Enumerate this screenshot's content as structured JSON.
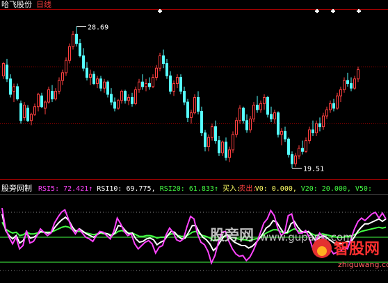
{
  "header": {
    "stock_name": "哈飞股份",
    "period_label": "日线"
  },
  "upper_chart": {
    "high_label": "28.69",
    "low_label": "19.51",
    "star_markers": 4,
    "colors": {
      "up": "#ff4040",
      "down": "#55ffff",
      "axis": "#b00000",
      "text": "#ffffff"
    }
  },
  "indicator": {
    "name": "股旁网制",
    "items": [
      {
        "label": "RSI5: 72.421↑",
        "color": "#ff44ff"
      },
      {
        "label": "RSI10: 69.775,",
        "color": "#ffffff"
      },
      {
        "label": "RSI20: 61.833↑",
        "color": "#44ff44"
      },
      {
        "label": "买入:",
        "color": "#ffff66"
      },
      {
        "label": "卖出:",
        "color": "#ff4040"
      },
      {
        "label": "V0: 0.000,",
        "color": "#ffff66"
      },
      {
        "label": "V20: 20.000,",
        "color": "#44ff44"
      },
      {
        "label": "V50:",
        "color": "#44ff44"
      }
    ]
  },
  "watermark": {
    "site_cn": "股旁网",
    "site_url": "www.gupang.com",
    "logo_text": "智股网",
    "logo_url": "zhiguwang.com"
  },
  "chart_data": [
    {
      "type": "candlestick",
      "title": "",
      "ylim": [
        18.9,
        29.7
      ],
      "high_label": 28.69,
      "low_label": 19.51,
      "candles": [
        [
          25.5,
          26.4,
          25.3,
          26.3
        ],
        [
          26.2,
          26.6,
          25.1,
          25.3
        ],
        [
          25.3,
          25.6,
          24.1,
          24.3
        ],
        [
          24.5,
          25.0,
          23.8,
          24.8
        ],
        [
          24.8,
          25.0,
          23.9,
          24.0
        ],
        [
          23.7,
          23.9,
          22.4,
          22.6
        ],
        [
          22.8,
          23.8,
          22.6,
          23.6
        ],
        [
          23.4,
          23.6,
          22.5,
          22.6
        ],
        [
          22.6,
          23.1,
          22.3,
          23.0
        ],
        [
          23.0,
          23.7,
          22.9,
          23.5
        ],
        [
          23.5,
          24.4,
          23.2,
          24.3
        ],
        [
          24.2,
          24.4,
          23.4,
          23.5
        ],
        [
          23.4,
          23.9,
          23.0,
          23.8
        ],
        [
          23.8,
          24.8,
          23.7,
          24.6
        ],
        [
          24.5,
          24.9,
          23.8,
          24.0
        ],
        [
          24.0,
          24.7,
          23.9,
          24.5
        ],
        [
          24.5,
          25.4,
          24.3,
          25.2
        ],
        [
          25.2,
          25.9,
          24.9,
          25.7
        ],
        [
          25.7,
          26.7,
          25.5,
          26.5
        ],
        [
          26.5,
          27.6,
          26.3,
          27.4
        ],
        [
          27.4,
          28.4,
          27.2,
          28.2
        ],
        [
          28.2,
          28.69,
          27.4,
          27.6
        ],
        [
          27.6,
          27.9,
          26.7,
          26.8
        ],
        [
          26.8,
          27.3,
          25.8,
          26.0
        ],
        [
          26.0,
          26.4,
          25.2,
          25.4
        ],
        [
          25.4,
          25.9,
          24.9,
          25.6
        ],
        [
          25.6,
          25.8,
          24.9,
          25.0
        ],
        [
          25.0,
          25.5,
          24.7,
          25.3
        ],
        [
          25.3,
          25.5,
          24.5,
          24.7
        ],
        [
          24.7,
          25.3,
          24.4,
          25.1
        ],
        [
          25.1,
          25.2,
          24.1,
          24.3
        ],
        [
          24.3,
          24.7,
          23.6,
          23.8
        ],
        [
          23.8,
          24.1,
          23.2,
          23.4
        ],
        [
          23.4,
          24.0,
          23.3,
          23.9
        ],
        [
          23.9,
          24.6,
          23.7,
          24.5
        ],
        [
          24.5,
          24.6,
          23.7,
          23.9
        ],
        [
          23.9,
          24.3,
          23.6,
          24.1
        ],
        [
          24.1,
          24.4,
          23.5,
          23.7
        ],
        [
          23.7,
          24.8,
          23.6,
          24.6
        ],
        [
          24.6,
          25.3,
          24.4,
          25.1
        ],
        [
          25.1,
          25.6,
          24.6,
          24.8
        ],
        [
          24.8,
          25.3,
          24.5,
          25.0
        ],
        [
          25.0,
          25.4,
          24.6,
          24.8
        ],
        [
          24.8,
          25.6,
          24.7,
          25.4
        ],
        [
          25.4,
          26.2,
          25.2,
          26.0
        ],
        [
          26.0,
          27.0,
          25.8,
          26.8
        ],
        [
          26.8,
          27.2,
          26.0,
          26.3
        ],
        [
          26.3,
          26.6,
          25.3,
          25.5
        ],
        [
          25.5,
          25.8,
          24.3,
          24.5
        ],
        [
          24.5,
          25.2,
          24.2,
          25.0
        ],
        [
          25.0,
          25.6,
          24.7,
          25.4
        ],
        [
          25.4,
          25.6,
          24.3,
          24.5
        ],
        [
          24.5,
          24.8,
          23.6,
          23.8
        ],
        [
          23.8,
          24.0,
          22.5,
          22.8
        ],
        [
          22.8,
          23.3,
          22.4,
          23.1
        ],
        [
          23.1,
          24.3,
          23.0,
          24.1
        ],
        [
          24.1,
          24.5,
          23.0,
          23.2
        ],
        [
          23.2,
          23.5,
          21.6,
          21.8
        ],
        [
          21.8,
          22.0,
          20.6,
          20.9
        ],
        [
          20.9,
          21.7,
          20.6,
          21.5
        ],
        [
          21.5,
          22.4,
          21.3,
          22.2
        ],
        [
          22.2,
          22.6,
          21.1,
          21.3
        ],
        [
          21.3,
          21.6,
          20.3,
          20.5
        ],
        [
          20.5,
          21.3,
          20.3,
          21.2
        ],
        [
          21.2,
          21.5,
          20.0,
          20.2
        ],
        [
          20.2,
          20.9,
          19.9,
          20.7
        ],
        [
          20.7,
          21.9,
          20.5,
          21.7
        ],
        [
          21.7,
          22.8,
          21.5,
          22.6
        ],
        [
          22.6,
          23.6,
          22.4,
          23.4
        ],
        [
          23.4,
          23.5,
          22.4,
          22.6
        ],
        [
          22.6,
          23.0,
          21.8,
          22.0
        ],
        [
          22.0,
          22.9,
          21.8,
          22.7
        ],
        [
          22.7,
          23.8,
          22.5,
          23.6
        ],
        [
          23.6,
          24.2,
          23.1,
          23.3
        ],
        [
          23.3,
          23.9,
          23.1,
          23.7
        ],
        [
          23.7,
          24.3,
          23.3,
          24.1
        ],
        [
          24.1,
          24.2,
          22.8,
          23.0
        ],
        [
          23.0,
          23.5,
          22.5,
          22.7
        ],
        [
          22.7,
          23.3,
          22.4,
          23.1
        ],
        [
          23.1,
          23.2,
          21.5,
          21.7
        ],
        [
          21.7,
          22.1,
          21.0,
          21.9
        ],
        [
          21.9,
          22.2,
          21.2,
          21.4
        ],
        [
          21.4,
          21.5,
          20.2,
          20.4
        ],
        [
          20.4,
          20.6,
          19.51,
          19.8
        ],
        [
          19.8,
          20.5,
          19.6,
          20.3
        ],
        [
          20.3,
          21.0,
          20.1,
          20.8
        ],
        [
          20.8,
          21.3,
          20.4,
          20.6
        ],
        [
          20.6,
          21.5,
          20.5,
          21.3
        ],
        [
          21.3,
          22.2,
          21.1,
          22.0
        ],
        [
          22.0,
          22.6,
          21.6,
          21.8
        ],
        [
          21.8,
          22.6,
          21.6,
          22.4
        ],
        [
          22.4,
          22.8,
          21.9,
          22.2
        ],
        [
          22.2,
          23.1,
          22.0,
          22.9
        ],
        [
          22.9,
          23.5,
          22.7,
          23.3
        ],
        [
          23.3,
          23.9,
          23.1,
          23.7
        ],
        [
          23.7,
          24.0,
          23.2,
          23.4
        ],
        [
          23.4,
          24.4,
          23.3,
          24.2
        ],
        [
          24.2,
          24.8,
          23.8,
          24.6
        ],
        [
          24.6,
          25.4,
          24.4,
          25.2
        ],
        [
          25.2,
          25.7,
          24.8,
          25.0
        ],
        [
          25.0,
          25.4,
          24.5,
          24.7
        ],
        [
          24.7,
          25.5,
          24.6,
          25.3
        ],
        [
          25.3,
          26.1,
          25.1,
          25.9
        ]
      ]
    },
    {
      "type": "line",
      "title": "",
      "ylim": [
        0,
        100
      ],
      "reference_lines": [
        20,
        50
      ],
      "series": [
        {
          "name": "RSI5",
          "color": "#ff44ff",
          "values": [
            85,
            60,
            50,
            42,
            50,
            36,
            40,
            58,
            43,
            45,
            52,
            60,
            56,
            52,
            55,
            67,
            74,
            80,
            83,
            72,
            60,
            54,
            60,
            55,
            50,
            48,
            45,
            52,
            57,
            56,
            52,
            48,
            57,
            73,
            66,
            57,
            52,
            54,
            42,
            36,
            40,
            44,
            46,
            42,
            31,
            38,
            40,
            53,
            61,
            56,
            47,
            45,
            48,
            63,
            75,
            72,
            54,
            44,
            41,
            33,
            19,
            28,
            44,
            56,
            57,
            45,
            36,
            30,
            27,
            28,
            22,
            26,
            34,
            44,
            55,
            67,
            72,
            82,
            76,
            61,
            52,
            56,
            76,
            78,
            62,
            55,
            55,
            58,
            50,
            37,
            47,
            55,
            50,
            42,
            36,
            30,
            32,
            33,
            38,
            36,
            48,
            60,
            69,
            73,
            70,
            74,
            78,
            80,
            73,
            79,
            72
          ]
        },
        {
          "name": "RSI10",
          "color": "#ffffff",
          "values": [
            78,
            58,
            52,
            48,
            52,
            43,
            46,
            55,
            49,
            50,
            53,
            57,
            56,
            55,
            56,
            62,
            67,
            71,
            74,
            70,
            62,
            57,
            60,
            57,
            54,
            52,
            50,
            53,
            56,
            55,
            54,
            51,
            55,
            64,
            63,
            58,
            54,
            55,
            48,
            44,
            45,
            48,
            49,
            47,
            41,
            44,
            46,
            52,
            57,
            56,
            51,
            48,
            49,
            56,
            64,
            64,
            56,
            50,
            47,
            42,
            34,
            38,
            45,
            51,
            53,
            48,
            44,
            42,
            40,
            40,
            37,
            39,
            43,
            48,
            54,
            61,
            64,
            70,
            68,
            61,
            55,
            56,
            66,
            69,
            62,
            57,
            56,
            57,
            52,
            46,
            49,
            52,
            50,
            47,
            44,
            41,
            42,
            43,
            45,
            44,
            50,
            57,
            62,
            66,
            66,
            68,
            70,
            72,
            69,
            72
          ]
        },
        {
          "name": "RSI20",
          "color": "#44ff44",
          "values": [
            68,
            60,
            57,
            55,
            56,
            52,
            53,
            56,
            54,
            54,
            55,
            56,
            56,
            56,
            56,
            58,
            60,
            62,
            63,
            62,
            59,
            57,
            57,
            56,
            55,
            54,
            53,
            54,
            55,
            54,
            54,
            53,
            54,
            57,
            58,
            56,
            55,
            55,
            53,
            51,
            51,
            52,
            52,
            51,
            49,
            50,
            50,
            52,
            54,
            54,
            52,
            51,
            51,
            53,
            56,
            57,
            54,
            52,
            51,
            49,
            46,
            47,
            49,
            51,
            52,
            50,
            49,
            48,
            47,
            47,
            46,
            47,
            48,
            49,
            52,
            55,
            57,
            59,
            59,
            57,
            55,
            55,
            58,
            60,
            58,
            56,
            56,
            56,
            54,
            52,
            53,
            54,
            53,
            52,
            51,
            50,
            50,
            50,
            51,
            51,
            53,
            55,
            57,
            58,
            59,
            60,
            61,
            62,
            61,
            62
          ]
        }
      ]
    }
  ]
}
